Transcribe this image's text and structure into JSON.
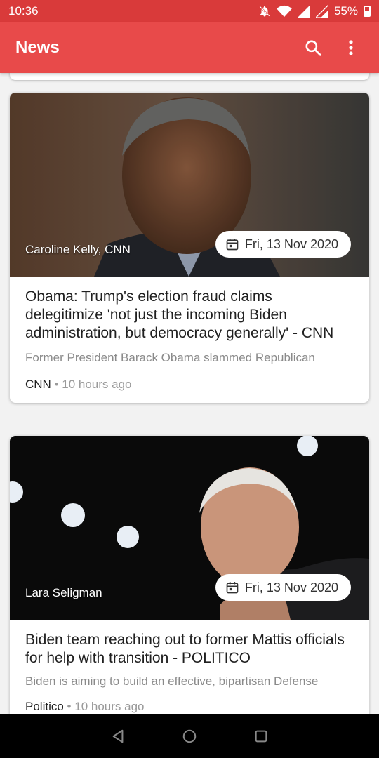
{
  "status_bar": {
    "time": "10:36",
    "battery": "55%"
  },
  "app_bar": {
    "title": "News"
  },
  "articles": [
    {
      "author": "Caroline Kelly, CNN",
      "date": "Fri, 13 Nov 2020",
      "headline": "Obama: Trump's election fraud claims delegitimize 'not just the incoming Biden administration, but democracy generally' - CNN",
      "summary": "Former President Barack Obama slammed Republican",
      "source": "CNN",
      "time_ago": "10 hours ago"
    },
    {
      "author": "Lara Seligman",
      "date": "Fri, 13 Nov 2020",
      "headline": "Biden team reaching out to former Mattis officials for help with transition - POLITICO",
      "summary": "Biden is aiming to build an effective, bipartisan Defense",
      "source": "Politico",
      "time_ago": "10 hours ago"
    }
  ],
  "colors": {
    "status_bar": "#d93a3a",
    "app_bar": "#e84a4a"
  }
}
